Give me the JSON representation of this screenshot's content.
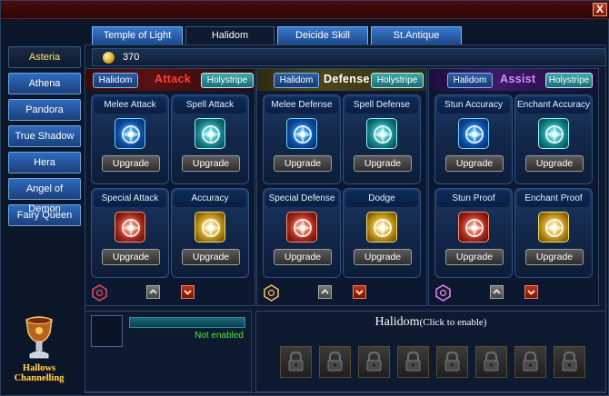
{
  "window": {
    "close_label": "X"
  },
  "tabs": [
    {
      "label": "Temple of Light"
    },
    {
      "label": "Halidom"
    },
    {
      "label": "Deicide Skill"
    },
    {
      "label": "St.Antique"
    }
  ],
  "active_tab": "Halidom",
  "sidebar": {
    "items": [
      {
        "label": "Asteria"
      },
      {
        "label": "Athena"
      },
      {
        "label": "Pandora"
      },
      {
        "label": "True Shadow"
      },
      {
        "label": "Hera"
      },
      {
        "label": "Angel of Demon"
      },
      {
        "label": "Fairy Queen"
      }
    ],
    "active": "Asteria"
  },
  "currency": {
    "value": "370",
    "icon": "coin-icon"
  },
  "panels": [
    {
      "title": "Attack",
      "title_color": "#ff3c3c",
      "halidom_label": "Halidom",
      "holystripe_label": "Holystripe",
      "cards": [
        {
          "label": "Melee Attack",
          "icon": "blue-rune-icon",
          "button": "Upgrade"
        },
        {
          "label": "Spell Attack",
          "icon": "teal-rune-icon",
          "button": "Upgrade"
        },
        {
          "label": "Special Attack",
          "icon": "red-rune-icon",
          "button": "Upgrade"
        },
        {
          "label": "Accuracy",
          "icon": "gold-rune-icon",
          "button": "Upgrade"
        }
      ]
    },
    {
      "title": "Defense",
      "title_color": "#ffffff",
      "halidom_label": "Halidom",
      "holystripe_label": "Holystripe",
      "cards": [
        {
          "label": "Melee Defense",
          "icon": "blue-rune-icon",
          "button": "Upgrade"
        },
        {
          "label": "Spell Defense",
          "icon": "teal-rune-icon",
          "button": "Upgrade"
        },
        {
          "label": "Special Defense",
          "icon": "red-rune-icon",
          "button": "Upgrade"
        },
        {
          "label": "Dodge",
          "icon": "gold-rune-icon",
          "button": "Upgrade"
        }
      ]
    },
    {
      "title": "Assist",
      "title_color": "#d78cff",
      "halidom_label": "Halidom",
      "holystripe_label": "Holystripe",
      "cards": [
        {
          "label": "Stun Accuracy",
          "icon": "blue-rune-icon",
          "button": "Upgrade"
        },
        {
          "label": "Enchant Accuracy",
          "icon": "teal-rune-icon",
          "button": "Upgrade"
        },
        {
          "label": "Stun Proof",
          "icon": "red-rune-icon",
          "button": "Upgrade"
        },
        {
          "label": "Enchant Proof",
          "icon": "gold-rune-icon",
          "button": "Upgrade"
        }
      ]
    }
  ],
  "bottom_left": {
    "status": "Not enabled",
    "status_color": "#52e63c"
  },
  "bottom_right": {
    "title": "Halidom",
    "subtitle": "(Click to enable)",
    "slot_count": 8,
    "slot_icon": "padlock-icon"
  },
  "cauldron": {
    "line1": "Hallows",
    "line2": "Channelling"
  }
}
